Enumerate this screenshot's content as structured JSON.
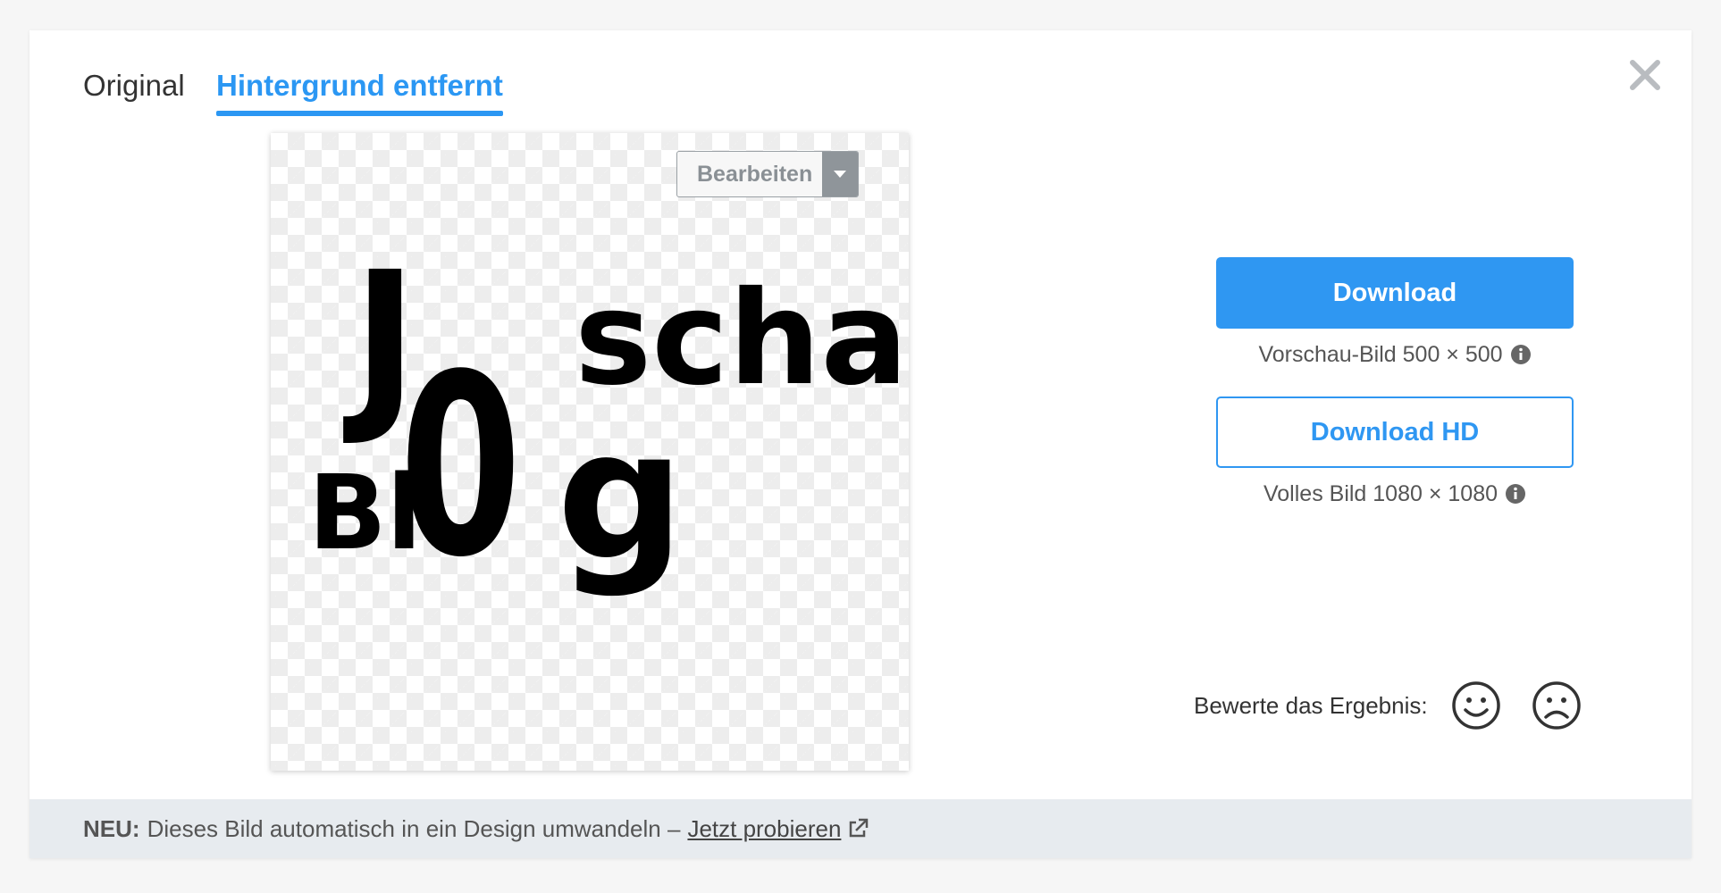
{
  "tabs": {
    "original": "Original",
    "removed": "Hintergrund entfernt"
  },
  "preview": {
    "edit_label": "Bearbeiten",
    "logo_letters": {
      "j": "J",
      "o": "0",
      "scha": "scha",
      "bl": "Bl",
      "g": "g"
    }
  },
  "download": {
    "label": "Download",
    "caption": "Vorschau-Bild 500 × 500"
  },
  "download_hd": {
    "label": "Download HD",
    "caption": "Volles Bild 1080 × 1080"
  },
  "rating": {
    "label": "Bewerte das Ergebnis:"
  },
  "footer": {
    "new_label": "NEU:",
    "text": "Dieses Bild automatisch in ein Design umwandeln –",
    "link": "Jetzt probieren"
  },
  "colors": {
    "accent": "#2f97f2",
    "footer_bg": "#e7ebef"
  }
}
